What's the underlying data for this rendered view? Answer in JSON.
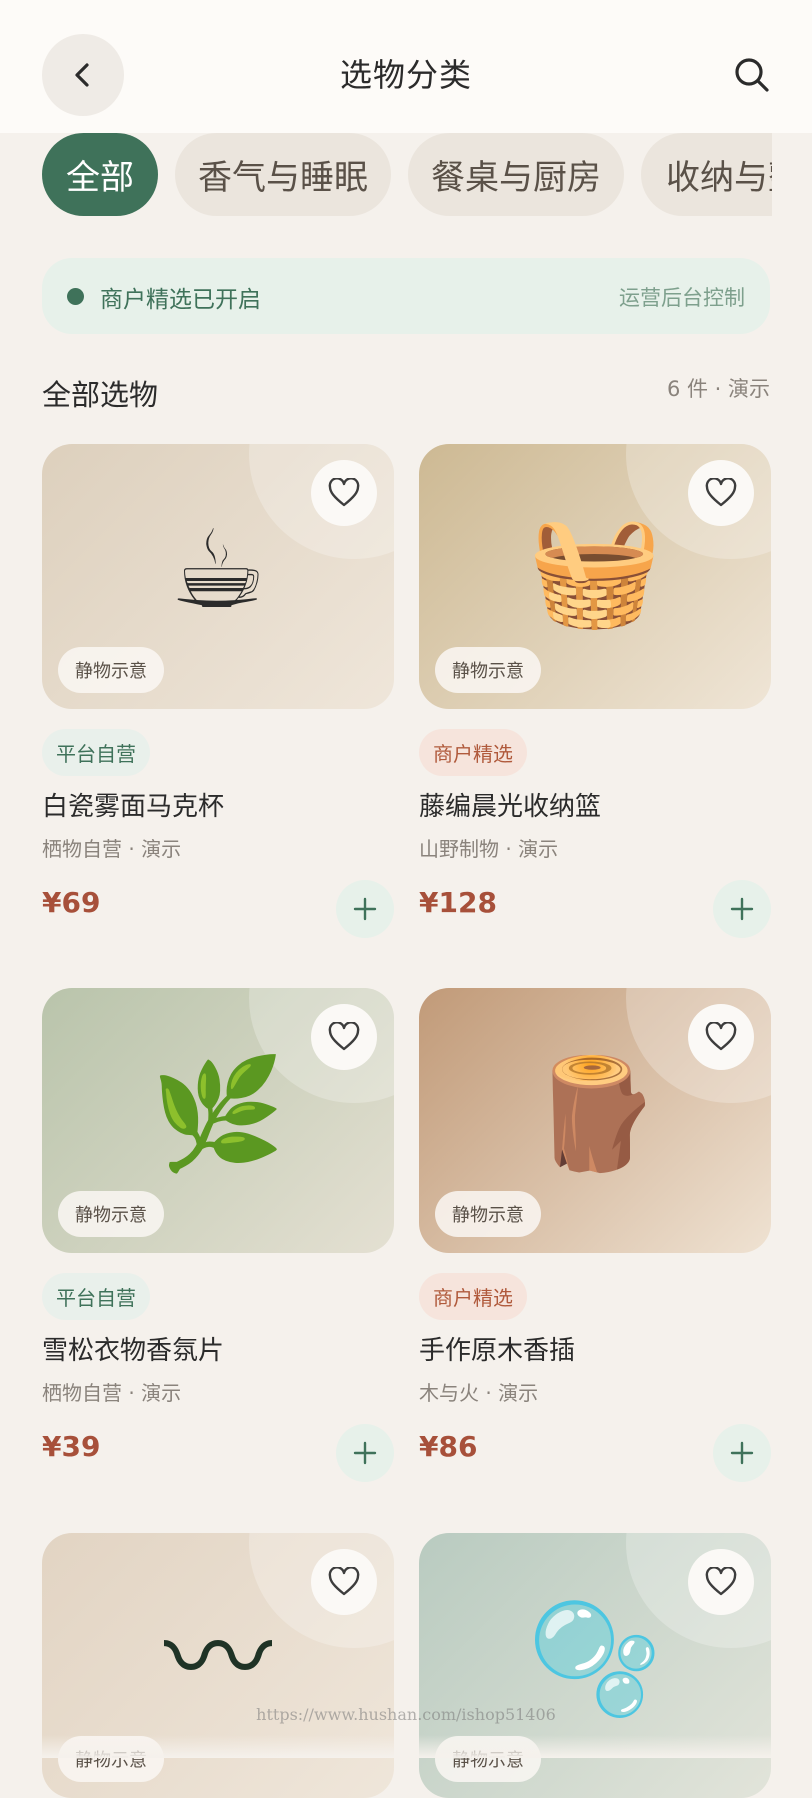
{
  "header": {
    "title": "选物分类"
  },
  "tabs": [
    {
      "label": "全部",
      "active": true
    },
    {
      "label": "香气与睡眠",
      "active": false
    },
    {
      "label": "餐桌与厨房",
      "active": false
    },
    {
      "label": "收纳与整理",
      "active": false
    }
  ],
  "notice": {
    "text": "商户精选已开启",
    "link": "运营后台控制"
  },
  "section": {
    "title": "全部选物",
    "count": "6 件 · 演示"
  },
  "products": [
    {
      "name": "白瓷雾面马克杯",
      "shop": "栖物自营 · 演示",
      "price": "¥69",
      "badge": "平台自营",
      "badge_type": "platform",
      "still": "静物示意",
      "emoji": "☕",
      "bg": "linear-gradient(135deg,#ddd0bd,#efe6da)"
    },
    {
      "name": "藤编晨光收纳篮",
      "shop": "山野制物 · 演示",
      "price": "¥128",
      "badge": "商户精选",
      "badge_type": "merchant",
      "still": "静物示意",
      "emoji": "🧺",
      "bg": "linear-gradient(135deg,#cdb993,#efe5d6)"
    },
    {
      "name": "雪松衣物香氛片",
      "shop": "栖物自营 · 演示",
      "price": "¥39",
      "badge": "平台自营",
      "badge_type": "platform",
      "still": "静物示意",
      "emoji": "🌿",
      "bg": "linear-gradient(135deg,#b9c4ab,#e4e0d2)"
    },
    {
      "name": "手作原木香插",
      "shop": "木与火 · 演示",
      "price": "¥86",
      "badge": "商户精选",
      "badge_type": "merchant",
      "still": "静物示意",
      "emoji": "🪵",
      "bg": "linear-gradient(135deg,#c19a78,#efe2d2)"
    },
    {
      "name": "",
      "shop": "",
      "price": "",
      "badge": "",
      "badge_type": "",
      "still": "静物示意",
      "emoji": "〰",
      "bg": "linear-gradient(135deg,#e2d4c3,#efe6da)"
    },
    {
      "name": "",
      "shop": "",
      "price": "",
      "badge": "",
      "badge_type": "",
      "still": "静物示意",
      "emoji": "🫧",
      "bg": "linear-gradient(135deg,#b9cbc0,#e2e4da)"
    }
  ],
  "watermark": "https://www.hushan.com/ishop51406"
}
